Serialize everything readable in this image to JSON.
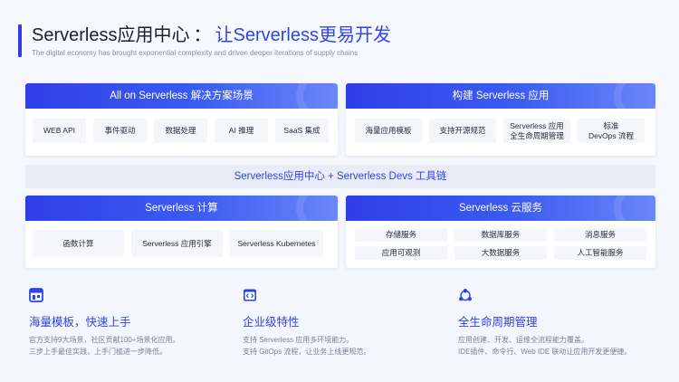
{
  "header": {
    "title_main": "Serverless应用中心",
    "title_sep": "：",
    "title_highlight": "让Serverless更易开发",
    "subtitle": "The digital economy has brought exponential complexity and driven deeper iterations of supply chains"
  },
  "panels": {
    "scenarios": {
      "title": "All on Serverless 解决方案场景",
      "items": [
        "WEB API",
        "事件驱动",
        "数据处理",
        "AI 推理",
        "SaaS 集成"
      ]
    },
    "build": {
      "title": "构建 Serverless 应用",
      "items": [
        "海量应用模板",
        "支持开源规范",
        "Serverless 应用\n全生命周期管理",
        "标准\nDevOps 流程"
      ]
    },
    "toolchain": "Serverless应用中心 + Serverless Devs 工具链",
    "compute": {
      "title": "Serverless 计算",
      "items": [
        "函数计算",
        "Serverless 应用引擎",
        "Serverless Kubernetes"
      ]
    },
    "cloud": {
      "title": "Serverless 云服务",
      "items": [
        "存储服务",
        "数据库服务",
        "消息服务",
        "应用可观测",
        "大数据服务",
        "人工智能服务"
      ]
    }
  },
  "features": [
    {
      "icon": "template-grid-icon",
      "title": "海量模板，快速上手",
      "lines": [
        "官方支持9大场景，社区贡献100+场景化应用。",
        "三步上手最佳实践，上手门槛进一步降低。"
      ]
    },
    {
      "icon": "code-window-icon",
      "title": "企业级特性",
      "lines": [
        "支持 Serverless 应用多环境能力。",
        "支持 GitOps 流程，让业务上线更规范。"
      ]
    },
    {
      "icon": "lifecycle-cycle-icon",
      "title": "全生命周期管理",
      "lines": [
        "应用创建、开发、运维全流程能力覆盖。",
        "IDE插件、命令行、Web IDE 联动让应用开发更便捷。"
      ]
    }
  ],
  "colors": {
    "accent": "#2f44e6",
    "panel_head": "#2f3ee8"
  }
}
